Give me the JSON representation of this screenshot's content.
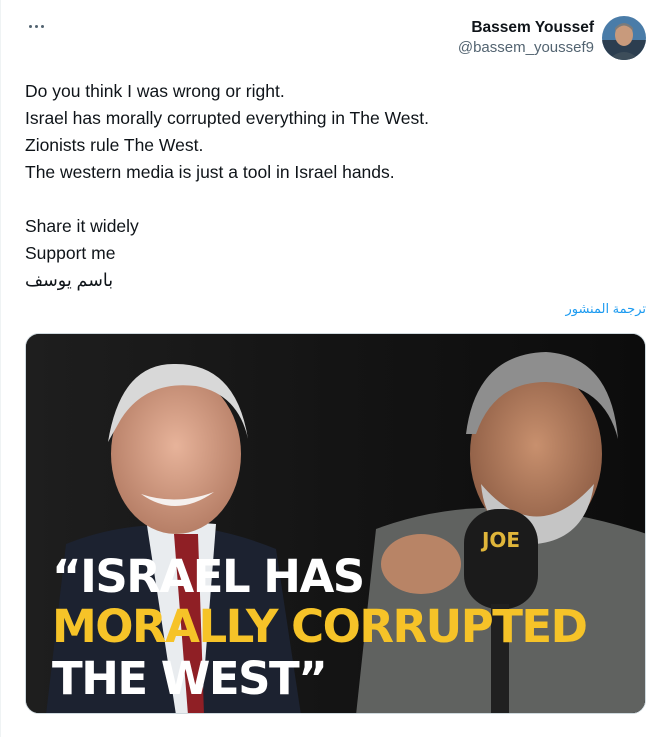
{
  "tweet": {
    "more_menu_icon": "more-horizontal-icon",
    "author_name": "Bassem Youssef",
    "author_handle": "@bassem_youssef9",
    "lines": [
      "Do you think I was wrong or right.",
      "Israel has morally corrupted everything in The West.",
      "Zionists rule The West.",
      "The western media is just a tool in Israel hands."
    ],
    "lines2": [
      "Share it widely",
      "Support me",
      "باسم يوسف"
    ],
    "translate_label": "ترجمة المنشور"
  },
  "media": {
    "headline_line1": "“ISRAEL HAS",
    "headline_line2": "MORALLY CORRUPTED",
    "headline_line3": "THE WEST”",
    "mic_logo": "JOE",
    "colors": {
      "highlight": "#f6c328",
      "background": "#111111"
    }
  }
}
